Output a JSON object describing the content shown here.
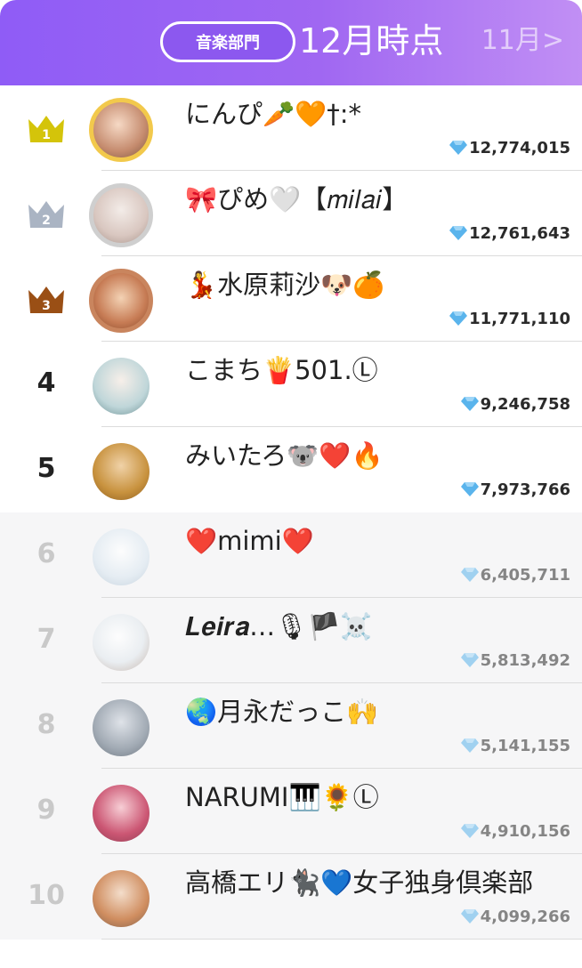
{
  "header": {
    "category": "音楽部門",
    "month_title": "12月時点",
    "prev_month": "11月>"
  },
  "ranking": [
    {
      "rank": "1",
      "name": "にんぴ🥕🧡†:*",
      "score": "12,774,015"
    },
    {
      "rank": "2",
      "name": "🎀ぴめ🤍【𝑚𝑖𝑙𝑎𝑖】",
      "score": "12,761,643"
    },
    {
      "rank": "3",
      "name": "💃水原莉沙🐶🍊",
      "score": "11,771,110"
    },
    {
      "rank": "4",
      "name": "こまち🍟501.Ⓛ",
      "score": "9,246,758"
    },
    {
      "rank": "5",
      "name": "みいたろ🐨❤️🔥",
      "score": "7,973,766"
    },
    {
      "rank": "6",
      "name": "❤️mimi❤️",
      "score": "6,405,711"
    },
    {
      "rank": "7",
      "name": "𝑳𝒆𝒊𝒓𝒂…🎙🏴☠️",
      "score": "5,813,492"
    },
    {
      "rank": "8",
      "name": "🌏月永だっこ🙌",
      "score": "5,141,155"
    },
    {
      "rank": "9",
      "name": "NARUMI🎹🌻Ⓛ",
      "score": "4,910,156"
    },
    {
      "rank": "10",
      "name": "高橋エリ🐈‍⬛💙女子独身倶楽部",
      "score": "4,099,266"
    }
  ],
  "colors": {
    "header_gradient_start": "#8f5cf6",
    "header_gradient_end": "#c18ff4",
    "gold_crown": "#d4c40a",
    "silver_crown": "#aab4c3",
    "bronze_crown": "#9a4f15",
    "gem": "#5ab4ec"
  },
  "icons": {
    "crown": "crown-icon",
    "gem": "diamond-gem-icon"
  }
}
